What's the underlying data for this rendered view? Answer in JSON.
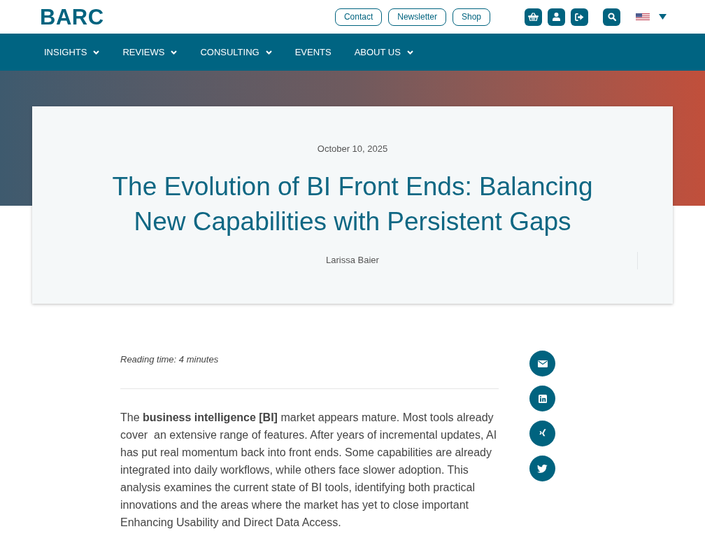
{
  "header": {
    "logo": "BARC",
    "links": [
      "Contact",
      "Newsletter",
      "Shop"
    ]
  },
  "nav": [
    {
      "label": "INSIGHTS",
      "dropdown": true
    },
    {
      "label": "REVIEWS",
      "dropdown": true
    },
    {
      "label": "CONSULTING",
      "dropdown": true
    },
    {
      "label": "EVENTS",
      "dropdown": false
    },
    {
      "label": "ABOUT US",
      "dropdown": true
    }
  ],
  "article": {
    "date": "October 10, 2025",
    "title": "The Evolution of BI Front Ends: Balancing New Capabilities with Persistent Gaps",
    "author": "Larissa Baier",
    "reading_time": "Reading time: 4 minutes",
    "intro": "The **business intelligence [BI]** market appears mature. Most tools already cover  an extensive range of features. After years of incremental updates, AI has put real momentum back into front ends. Some capabilities are already integrated into daily workflows, while others face slower adoption. This analysis examines the current state of BI tools, identifying both practical innovations and the areas where the market has yet to close important Enhancing Usability and Direct Data Access."
  }
}
